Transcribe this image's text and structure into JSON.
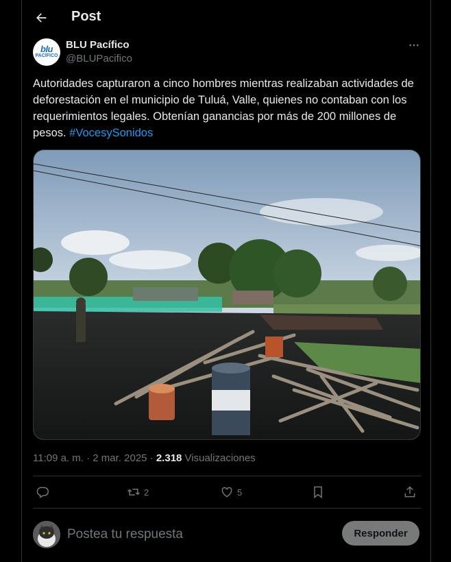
{
  "header": {
    "title": "Post",
    "back_icon": "arrow-left-icon"
  },
  "author": {
    "name": "BLU Pacífico",
    "handle": "@BLUPacifico",
    "avatar_text_top": "blu",
    "avatar_text_bottom": "PACÍFICO"
  },
  "post": {
    "text": "Autoridades capturaron a cinco hombres mientras realizaban actividades de deforestación en el municipio de Tuluá, Valle, quienes no contaban con los requerimientos legales. Obtenían ganancias por más de 200 millones de pesos. ",
    "hashtag": "#VocesySonidos"
  },
  "meta": {
    "time": "11:09 a. m.",
    "separator": " · ",
    "date": "2 mar. 2025",
    "views_count": "2.318",
    "views_label": " Visualizaciones"
  },
  "actions": {
    "reply_count": "",
    "repost_count": "2",
    "like_count": "5"
  },
  "reply": {
    "placeholder": "Postea tu respuesta",
    "button_label": "Responder"
  },
  "colors": {
    "accent": "#1d9bf0",
    "muted": "#71767b",
    "text": "#e7e9ea",
    "border": "#2f3336"
  }
}
